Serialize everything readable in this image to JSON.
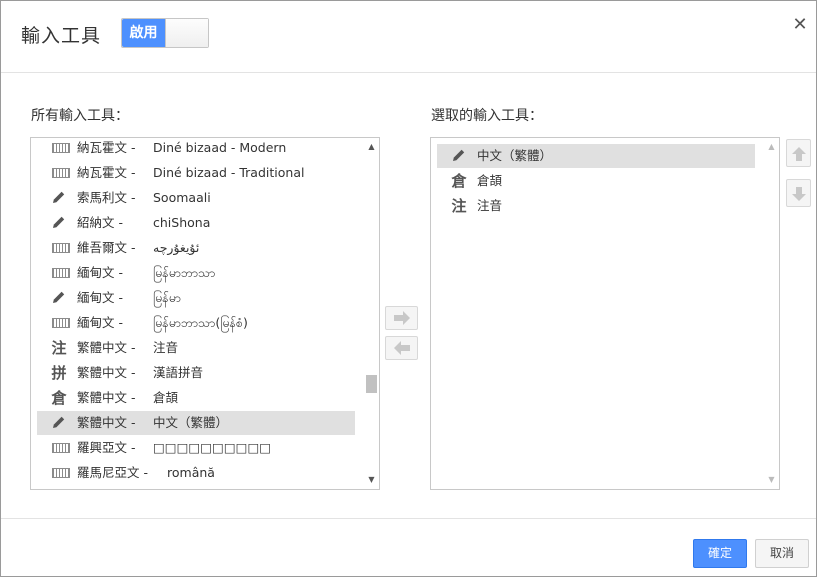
{
  "dialog": {
    "title": "輸入工具",
    "toggle_label": "啟用",
    "close_glyph": "✕"
  },
  "all_tools": {
    "label": "所有輸入工具：",
    "items": [
      {
        "icon": "keyboard-icon",
        "lang": "納瓦霍文 -",
        "name": "Diné bizaad - Modern",
        "selected": false
      },
      {
        "icon": "keyboard-icon",
        "lang": "納瓦霍文 -",
        "name": "Diné bizaad - Traditional",
        "selected": false
      },
      {
        "icon": "pencil-icon",
        "lang": "索馬利文 -",
        "name": "Soomaali",
        "selected": false
      },
      {
        "icon": "pencil-icon",
        "lang": "紹納文 -",
        "name": "chiShona",
        "selected": false
      },
      {
        "icon": "keyboard-icon",
        "lang": "維吾爾文 -",
        "name": "ئۇيغۇرچە",
        "selected": false
      },
      {
        "icon": "keyboard-icon",
        "lang": "緬甸文 -",
        "name": "မြန်မာဘာသာ",
        "selected": false
      },
      {
        "icon": "pencil-icon",
        "lang": "緬甸文 -",
        "name": "မြန်မာ",
        "selected": false
      },
      {
        "icon": "keyboard-icon",
        "lang": "緬甸文 -",
        "name": "မြန်မာဘာသာ(မြန်စံ)",
        "selected": false
      },
      {
        "icon": "zhuyin-icon",
        "glyph": "注",
        "lang": "繁體中文 -",
        "name": "注音",
        "selected": false
      },
      {
        "icon": "pinyin-icon",
        "glyph": "拼",
        "lang": "繁體中文 -",
        "name": "漢語拼音",
        "selected": false
      },
      {
        "icon": "cangjie-icon",
        "glyph": "倉",
        "lang": "繁體中文 -",
        "name": "倉頡",
        "selected": false
      },
      {
        "icon": "pencil-icon",
        "lang": "繁體中文 -",
        "name": "中文（繁體）",
        "selected": true
      },
      {
        "icon": "keyboard-icon",
        "lang": "羅興亞文 -",
        "name": "□□□□□□□□□□",
        "selected": false
      },
      {
        "icon": "keyboard-icon",
        "lang": "羅馬尼亞文 -",
        "name": "română",
        "selected": false
      }
    ]
  },
  "selected_tools": {
    "label": "選取的輸入工具：",
    "items": [
      {
        "icon": "pencil-icon",
        "name": "中文（繁體）",
        "selected": true
      },
      {
        "icon": "cangjie-icon",
        "glyph": "倉",
        "name": "倉頡",
        "selected": false
      },
      {
        "icon": "zhuyin-icon",
        "glyph": "注",
        "name": "注音",
        "selected": false
      }
    ]
  },
  "buttons": {
    "ok": "確定",
    "cancel": "取消"
  }
}
